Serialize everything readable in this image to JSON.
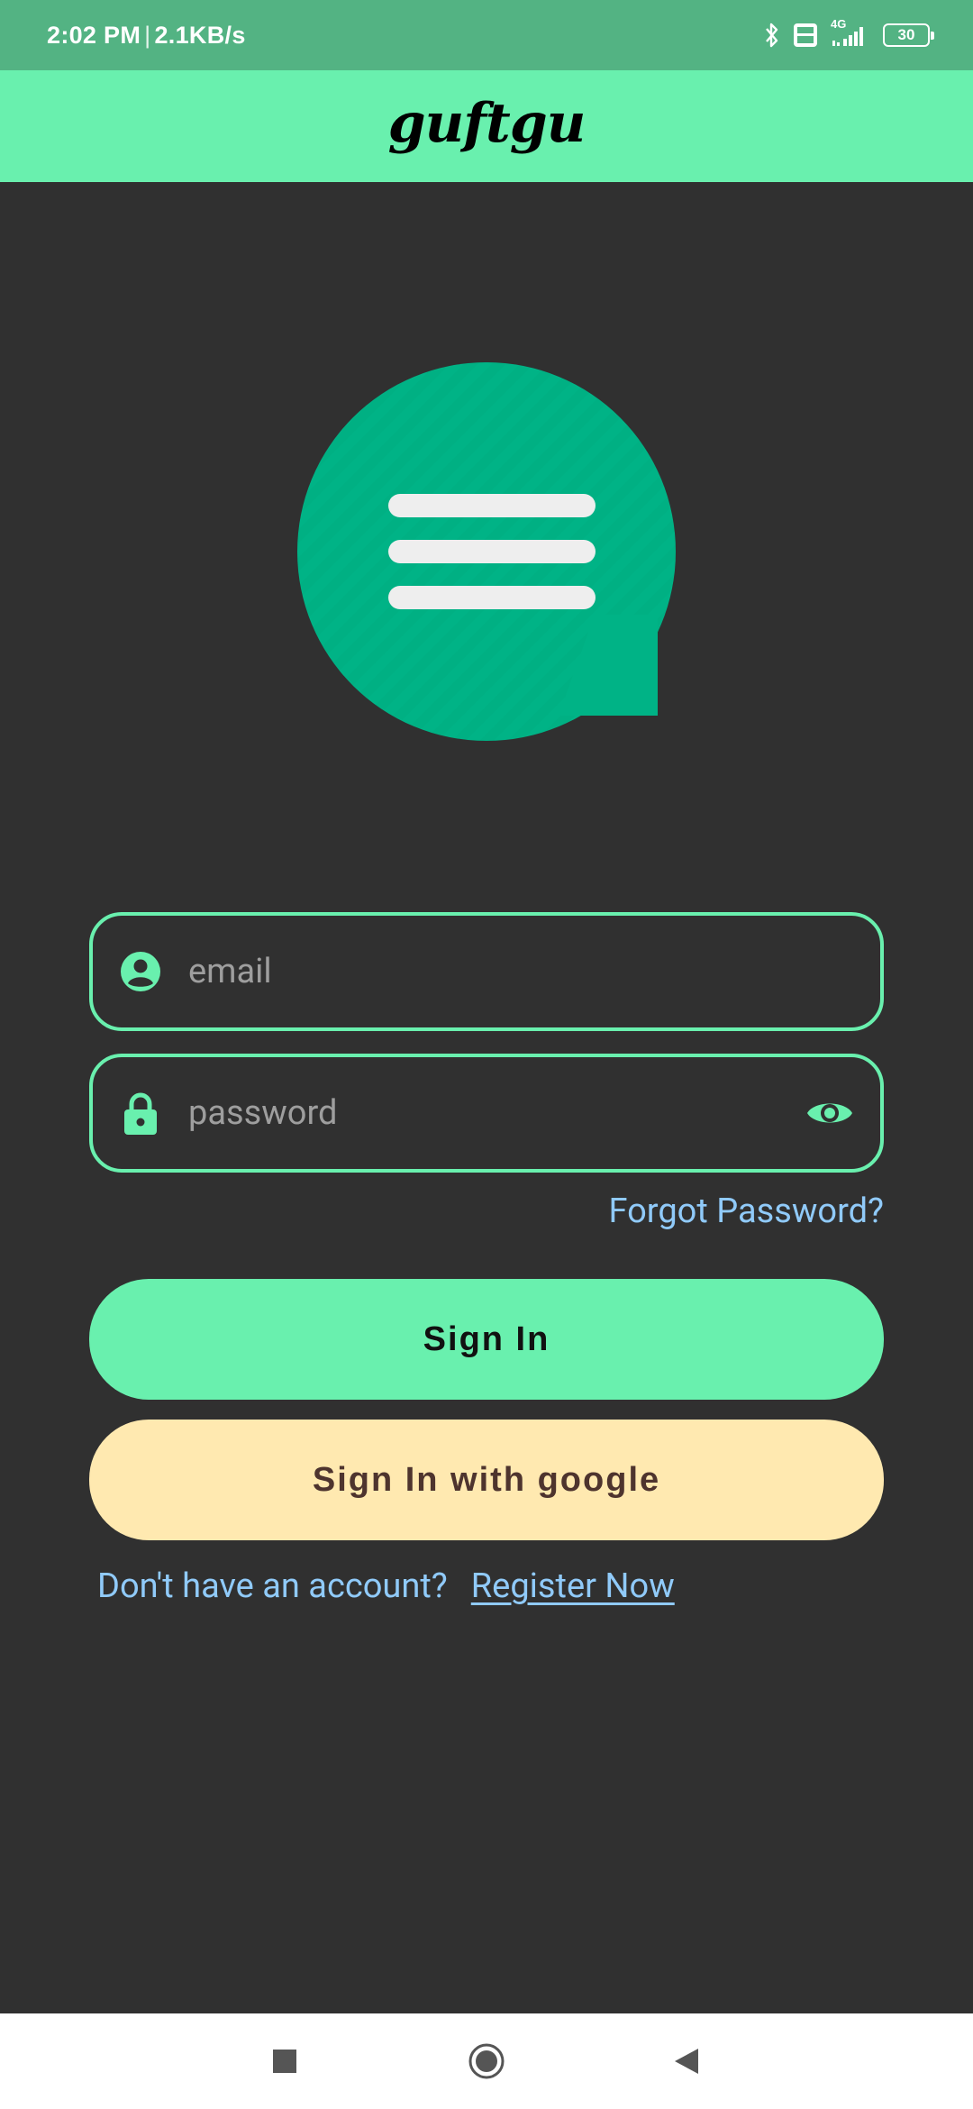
{
  "status_bar": {
    "time": "2:02 PM",
    "separator": "|",
    "speed": "2.1KB/s",
    "network": "4G",
    "battery": "30",
    "icons": [
      "bluetooth-icon",
      "volte-icon",
      "signal-icon",
      "battery-icon"
    ]
  },
  "app_bar": {
    "title": "guftgu"
  },
  "logo": {
    "icon": "chat-bubble-icon",
    "color": "#00b386",
    "lines_color": "#eeeeee"
  },
  "form": {
    "email": {
      "placeholder": "email",
      "icon": "account-circle-icon"
    },
    "password": {
      "placeholder": "password",
      "icon": "lock-icon",
      "toggle_icon": "eye-icon"
    },
    "forgot_label": "Forgot Password?",
    "signin_label": "Sign In",
    "google_label": "Sign In with google",
    "register_prompt": "Don't have an account?",
    "register_link": "Register Now"
  },
  "nav_bar": {
    "icons": [
      "recents-square-icon",
      "home-circle-icon",
      "back-triangle-icon"
    ]
  },
  "colors": {
    "accent": "#69f0ae",
    "status_bar": "#53b383",
    "background": "#303030",
    "link": "#90caf9",
    "google_button": "#ffe9b0",
    "google_text": "#4e342e"
  }
}
